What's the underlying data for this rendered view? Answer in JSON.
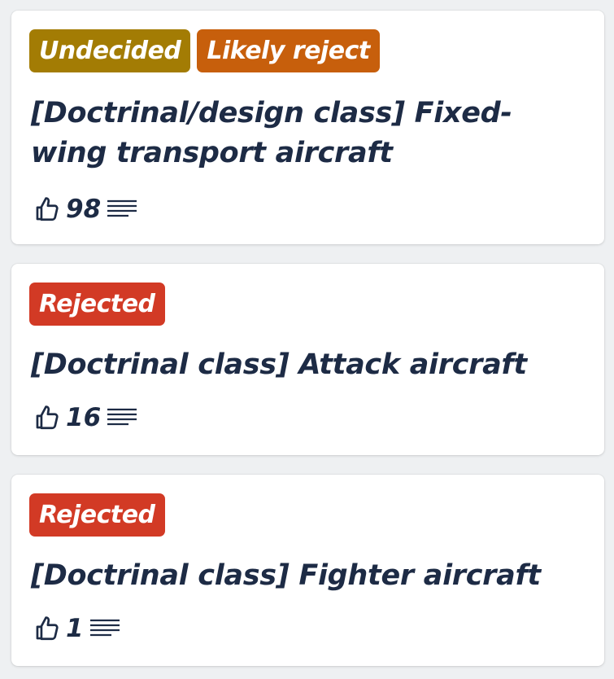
{
  "colors": {
    "undecided": "#a37c04",
    "likely_reject": "#c75f0c",
    "rejected": "#d23a25",
    "text": "#1d2b45"
  },
  "ideas": [
    {
      "badges": [
        {
          "label": "Undecided",
          "status": "undecided"
        },
        {
          "label": "Likely reject",
          "status": "likely_reject"
        }
      ],
      "title": "[Doctrinal/design class] Fixed-wing transport aircraft",
      "votes": "98",
      "vote_icon": "thumbs-up-icon",
      "comments_icon": "lines-icon"
    },
    {
      "badges": [
        {
          "label": "Rejected",
          "status": "rejected"
        }
      ],
      "title": "[Doctrinal class] Attack aircraft",
      "votes": "16",
      "vote_icon": "thumbs-up-icon",
      "comments_icon": "lines-icon"
    },
    {
      "badges": [
        {
          "label": "Rejected",
          "status": "rejected"
        }
      ],
      "title": "[Doctrinal class] Fighter aircraft",
      "votes": "1",
      "vote_icon": "thumbs-up-icon",
      "comments_icon": "lines-icon"
    }
  ]
}
